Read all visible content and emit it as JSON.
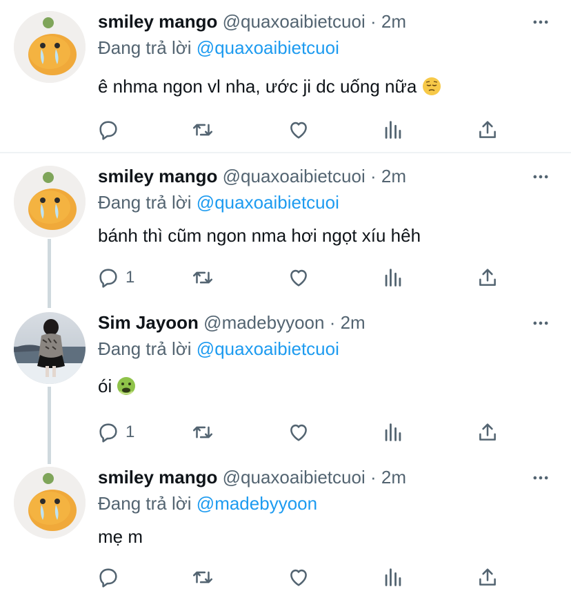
{
  "tweets": [
    {
      "name": "smiley mango",
      "handle": "@quaxoaibietcuoi",
      "dot": "·",
      "time": "2m",
      "replying_prefix": "Đang trả lời",
      "replying_to": "@quaxoaibietcuoi",
      "text": "ê nhma ngon vl nha, ước ji dc uống nữa",
      "emoji": "pensive-face",
      "avatar": "mango-avatar",
      "reply_count": ""
    },
    {
      "name": "smiley mango",
      "handle": "@quaxoaibietcuoi",
      "dot": "·",
      "time": "2m",
      "replying_prefix": "Đang trả lời",
      "replying_to": "@quaxoaibietcuoi",
      "text": "bánh thì cũm ngon nma hơi ngọt xíu hêh",
      "avatar": "mango-avatar",
      "reply_count": "1"
    },
    {
      "name": "Sim Jayoon",
      "handle": "@madebyyoon",
      "dot": "·",
      "time": "2m",
      "replying_prefix": "Đang trả lời",
      "replying_to": "@quaxoaibietcuoi",
      "text": "ói",
      "emoji": "nauseated-face",
      "avatar": "photo-avatar",
      "reply_count": "1"
    },
    {
      "name": "smiley mango",
      "handle": "@quaxoaibietcuoi",
      "dot": "·",
      "time": "2m",
      "replying_prefix": "Đang trả lời",
      "replying_to": "@madebyyoon",
      "text": "mẹ m",
      "avatar": "mango-avatar",
      "reply_count": ""
    }
  ],
  "colors": {
    "link": "#1d9bf0",
    "secondary_text": "#536471",
    "thread_line": "#cfd9de"
  },
  "icons": [
    "reply-icon",
    "retweet-icon",
    "like-icon",
    "analytics-icon",
    "share-icon",
    "more-icon"
  ]
}
